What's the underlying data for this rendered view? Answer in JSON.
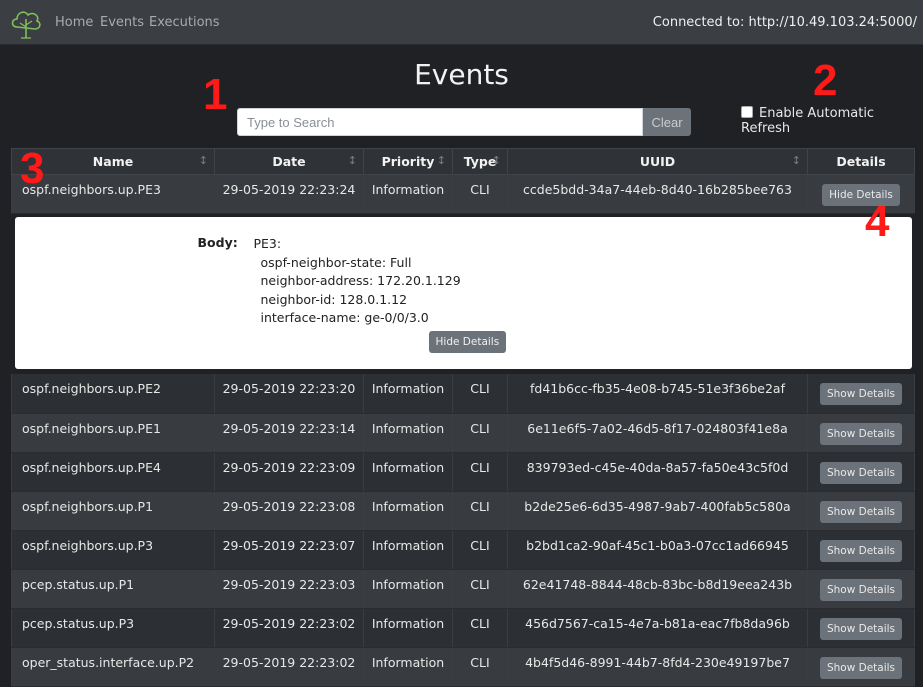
{
  "nav": {
    "links": [
      "Home",
      "Events",
      "Executions"
    ],
    "connected_text": "Connected to: http://10.49.103.24:5000/"
  },
  "page_title": "Events",
  "search": {
    "placeholder": "Type to Search",
    "clear_label": "Clear"
  },
  "auto_refresh": {
    "label": "Enable Automatic Refresh",
    "checked": false
  },
  "markers": [
    "1",
    "2",
    "3",
    "4"
  ],
  "table": {
    "headers": [
      "Name",
      "Date",
      "Priority",
      "Type",
      "UUID",
      "Details"
    ],
    "expanded_row": {
      "name": "ospf.neighbors.up.PE3",
      "date": "29-05-2019 22:23:24",
      "priority": "Information",
      "type": "CLI",
      "uuid": "ccde5bdd-34a7-44eb-8d40-16b285bee763",
      "button": "Hide Details",
      "body_label": "Body:",
      "body_lines": [
        "PE3:",
        "ospf-neighbor-state: Full",
        "neighbor-address: 172.20.1.129",
        "neighbor-id: 128.0.1.12",
        "interface-name: ge-0/0/3.0"
      ],
      "inner_button": "Hide Details"
    },
    "rows": [
      {
        "name": "ospf.neighbors.up.PE2",
        "date": "29-05-2019 22:23:20",
        "priority": "Information",
        "type": "CLI",
        "uuid": "fd41b6cc-fb35-4e08-b745-51e3f36be2af",
        "button": "Show Details"
      },
      {
        "name": "ospf.neighbors.up.PE1",
        "date": "29-05-2019 22:23:14",
        "priority": "Information",
        "type": "CLI",
        "uuid": "6e11e6f5-7a02-46d5-8f17-024803f41e8a",
        "button": "Show Details"
      },
      {
        "name": "ospf.neighbors.up.PE4",
        "date": "29-05-2019 22:23:09",
        "priority": "Information",
        "type": "CLI",
        "uuid": "839793ed-c45e-40da-8a57-fa50e43c5f0d",
        "button": "Show Details"
      },
      {
        "name": "ospf.neighbors.up.P1",
        "date": "29-05-2019 22:23:08",
        "priority": "Information",
        "type": "CLI",
        "uuid": "b2de25e6-6d35-4987-9ab7-400fab5c580a",
        "button": "Show Details"
      },
      {
        "name": "ospf.neighbors.up.P3",
        "date": "29-05-2019 22:23:07",
        "priority": "Information",
        "type": "CLI",
        "uuid": "b2bd1ca2-90af-45c1-b0a3-07cc1ad66945",
        "button": "Show Details"
      },
      {
        "name": "pcep.status.up.P1",
        "date": "29-05-2019 22:23:03",
        "priority": "Information",
        "type": "CLI",
        "uuid": "62e41748-8844-48cb-83bc-b8d19eea243b",
        "button": "Show Details"
      },
      {
        "name": "pcep.status.up.P3",
        "date": "29-05-2019 22:23:02",
        "priority": "Information",
        "type": "CLI",
        "uuid": "456d7567-ca15-4e7a-b81a-eac7fb8da96b",
        "button": "Show Details"
      },
      {
        "name": "oper_status.interface.up.P2",
        "date": "29-05-2019 22:23:02",
        "priority": "Information",
        "type": "CLI",
        "uuid": "4b4f5d46-8991-44b7-8fd4-230e49197be7",
        "button": "Show Details"
      }
    ]
  },
  "colors": {
    "background": "#1f2124",
    "navbar": "#3b3e42",
    "button": "#6c7279",
    "marker": "#ff1a1a",
    "logo": "#7fbf5a"
  },
  "icons": {
    "brand": "tree-logo-icon",
    "sort": "sort-arrows-icon",
    "checkbox": "checkbox-icon"
  }
}
